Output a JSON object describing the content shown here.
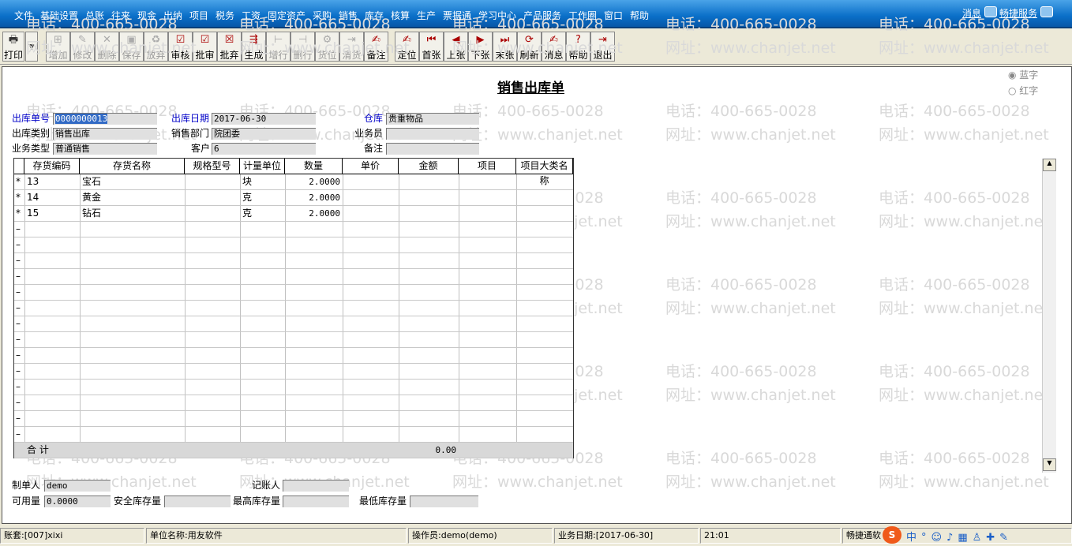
{
  "menu": [
    "文件",
    "基础设置",
    "总账",
    "往来",
    "现金",
    "出纳",
    "项目",
    "税务",
    "工资",
    "固定资产",
    "采购",
    "销售",
    "库存",
    "核算",
    "生产",
    "票据通",
    "学习中心",
    "产品服务",
    "工作圈",
    "窗口",
    "帮助"
  ],
  "top_right": {
    "messages": "消息",
    "service": "畅捷服务"
  },
  "toolbar": {
    "print": "打印",
    "buttons": [
      {
        "label": "增加",
        "icon": "add-icon",
        "ic": "⊞",
        "enabled": false
      },
      {
        "label": "修改",
        "icon": "edit-icon",
        "ic": "✎",
        "enabled": false
      },
      {
        "label": "删除",
        "icon": "delete-icon",
        "ic": "✕",
        "enabled": false
      },
      {
        "label": "保存",
        "icon": "save-icon",
        "ic": "▣",
        "enabled": false
      },
      {
        "label": "放弃",
        "icon": "discard-icon",
        "ic": "♻",
        "enabled": false
      },
      {
        "label": "审核",
        "icon": "approve-icon",
        "ic": "☑",
        "enabled": true
      },
      {
        "label": "批审",
        "icon": "batch-approve-icon",
        "ic": "☑",
        "enabled": true
      },
      {
        "label": "批弃",
        "icon": "batch-abandon-icon",
        "ic": "☒",
        "enabled": true
      },
      {
        "label": "生成",
        "icon": "generate-icon",
        "ic": "⇶",
        "enabled": true
      },
      {
        "label": "增行",
        "icon": "add-row-icon",
        "ic": "⊢",
        "enabled": false
      },
      {
        "label": "删行",
        "icon": "delete-row-icon",
        "ic": "⊣",
        "enabled": false
      },
      {
        "label": "货位",
        "icon": "location-icon",
        "ic": "⚙",
        "enabled": false
      },
      {
        "label": "清货",
        "icon": "clear-goods-icon",
        "ic": "⇥",
        "enabled": false
      },
      {
        "label": "备注",
        "icon": "note-icon",
        "ic": "✍",
        "enabled": true
      }
    ],
    "nav_buttons": [
      {
        "label": "定位",
        "icon": "locate-icon",
        "ic": "✍"
      },
      {
        "label": "首张",
        "icon": "first-icon",
        "ic": "⏮"
      },
      {
        "label": "上张",
        "icon": "prev-icon",
        "ic": "◀"
      },
      {
        "label": "下张",
        "icon": "next-icon",
        "ic": "▶"
      },
      {
        "label": "末张",
        "icon": "last-icon",
        "ic": "⏭"
      },
      {
        "label": "刷新",
        "icon": "refresh-icon",
        "ic": "⟳"
      },
      {
        "label": "消息",
        "icon": "message-icon",
        "ic": "✍"
      },
      {
        "label": "帮助",
        "icon": "help-icon",
        "ic": "?"
      },
      {
        "label": "退出",
        "icon": "exit-icon",
        "ic": "⇥"
      }
    ]
  },
  "watermark": {
    "phone": "电话：400-665-0028",
    "site": "网址：www.chanjet.net"
  },
  "form": {
    "title": "销售出库单",
    "radio_blue": "蓝字",
    "radio_red": "红字",
    "fields": {
      "out_no_label": "出库单号",
      "out_no": "0000000013",
      "out_date_label": "出库日期",
      "out_date": "2017-06-30",
      "warehouse_label": "仓库",
      "warehouse": "贵重物品",
      "out_type_label": "出库类别",
      "out_type": "销售出库",
      "dept_label": "销售部门",
      "dept": "院团委",
      "salesman_label": "业务员",
      "salesman": "",
      "biz_type_label": "业务类型",
      "biz_type": "普通销售",
      "customer_label": "客户",
      "customer": "6",
      "remark_label": "备注",
      "remark": ""
    }
  },
  "grid": {
    "headers": [
      "存货编码",
      "存货名称",
      "规格型号",
      "计量单位",
      "数量",
      "单价",
      "金额",
      "项目",
      "项目大类名称"
    ],
    "rows": [
      [
        "13",
        "宝石",
        "",
        "块",
        "2.0000",
        "",
        "",
        "",
        ""
      ],
      [
        "14",
        "黄金",
        "",
        "克",
        "2.0000",
        "",
        "",
        "",
        ""
      ],
      [
        "15",
        "钻石",
        "",
        "克",
        "2.0000",
        "",
        "",
        "",
        ""
      ]
    ],
    "total_label": "合  计",
    "total_amount": "0.00"
  },
  "footer": {
    "maker_label": "制单人",
    "maker": "demo",
    "bookkeeper_label": "记账人",
    "bookkeeper": "",
    "available_label": "可用量",
    "available": "0.0000",
    "safety_label": "安全库存量",
    "safety": "",
    "max_label": "最高库存量",
    "max": "",
    "min_label": "最低库存量",
    "min": ""
  },
  "status": {
    "account": "账套:[007]xixi",
    "company": "单位名称:用友软件",
    "operator": "操作员:demo(demo)",
    "biz_date": "业务日期:[2017-06-30]",
    "time": "21:01",
    "brand": "畅捷通软"
  }
}
